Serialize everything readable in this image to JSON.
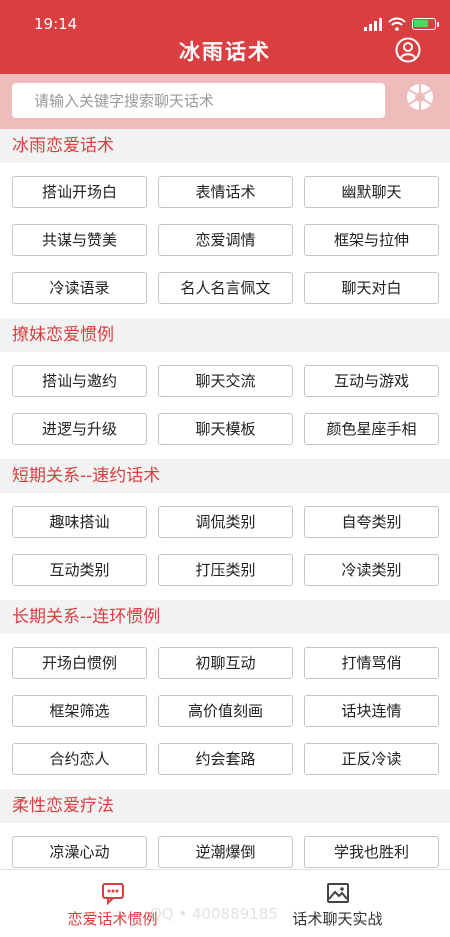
{
  "status_bar": {
    "time": "19:14"
  },
  "header": {
    "title": "冰雨话术"
  },
  "search": {
    "placeholder": "请输入关键字搜索聊天话术"
  },
  "sections": [
    {
      "title": "冰雨恋爱话术",
      "items": [
        "搭讪开场白",
        "表情话术",
        "幽默聊天",
        "共谋与赞美",
        "恋爱调情",
        "框架与拉伸",
        "冷读语录",
        "名人名言佩文",
        "聊天对白"
      ]
    },
    {
      "title": "撩妹恋爱惯例",
      "items": [
        "搭讪与邀约",
        "聊天交流",
        "互动与游戏",
        "进逻与升级",
        "聊天模板",
        "颜色星座手相"
      ]
    },
    {
      "title": "短期关系--速约话术",
      "items": [
        "趣味搭讪",
        "调侃类别",
        "自夸类别",
        "互动类别",
        "打压类别",
        "冷读类别"
      ]
    },
    {
      "title": "长期关系--连环惯例",
      "items": [
        "开场白惯例",
        "初聊互动",
        "打情骂俏",
        "框架筛选",
        "高价值刻画",
        "话块连情",
        "合约恋人",
        "约会套路",
        "正反冷读"
      ]
    },
    {
      "title": "柔性恋爱疗法",
      "items": [
        "凉澡心动",
        "逆潮爆倒",
        "学我也胜利"
      ]
    }
  ],
  "tabbar": {
    "tabs": [
      {
        "label": "恋爱话术惯例",
        "icon": "chat-bubble-icon",
        "active": true
      },
      {
        "label": "话术聊天实战",
        "icon": "image-icon",
        "active": false
      }
    ]
  },
  "watermark": "QQ • 400889185",
  "colors": {
    "accent": "#d93e40",
    "search_bg": "#efbcbc",
    "section_bg": "#f2f2f2"
  }
}
